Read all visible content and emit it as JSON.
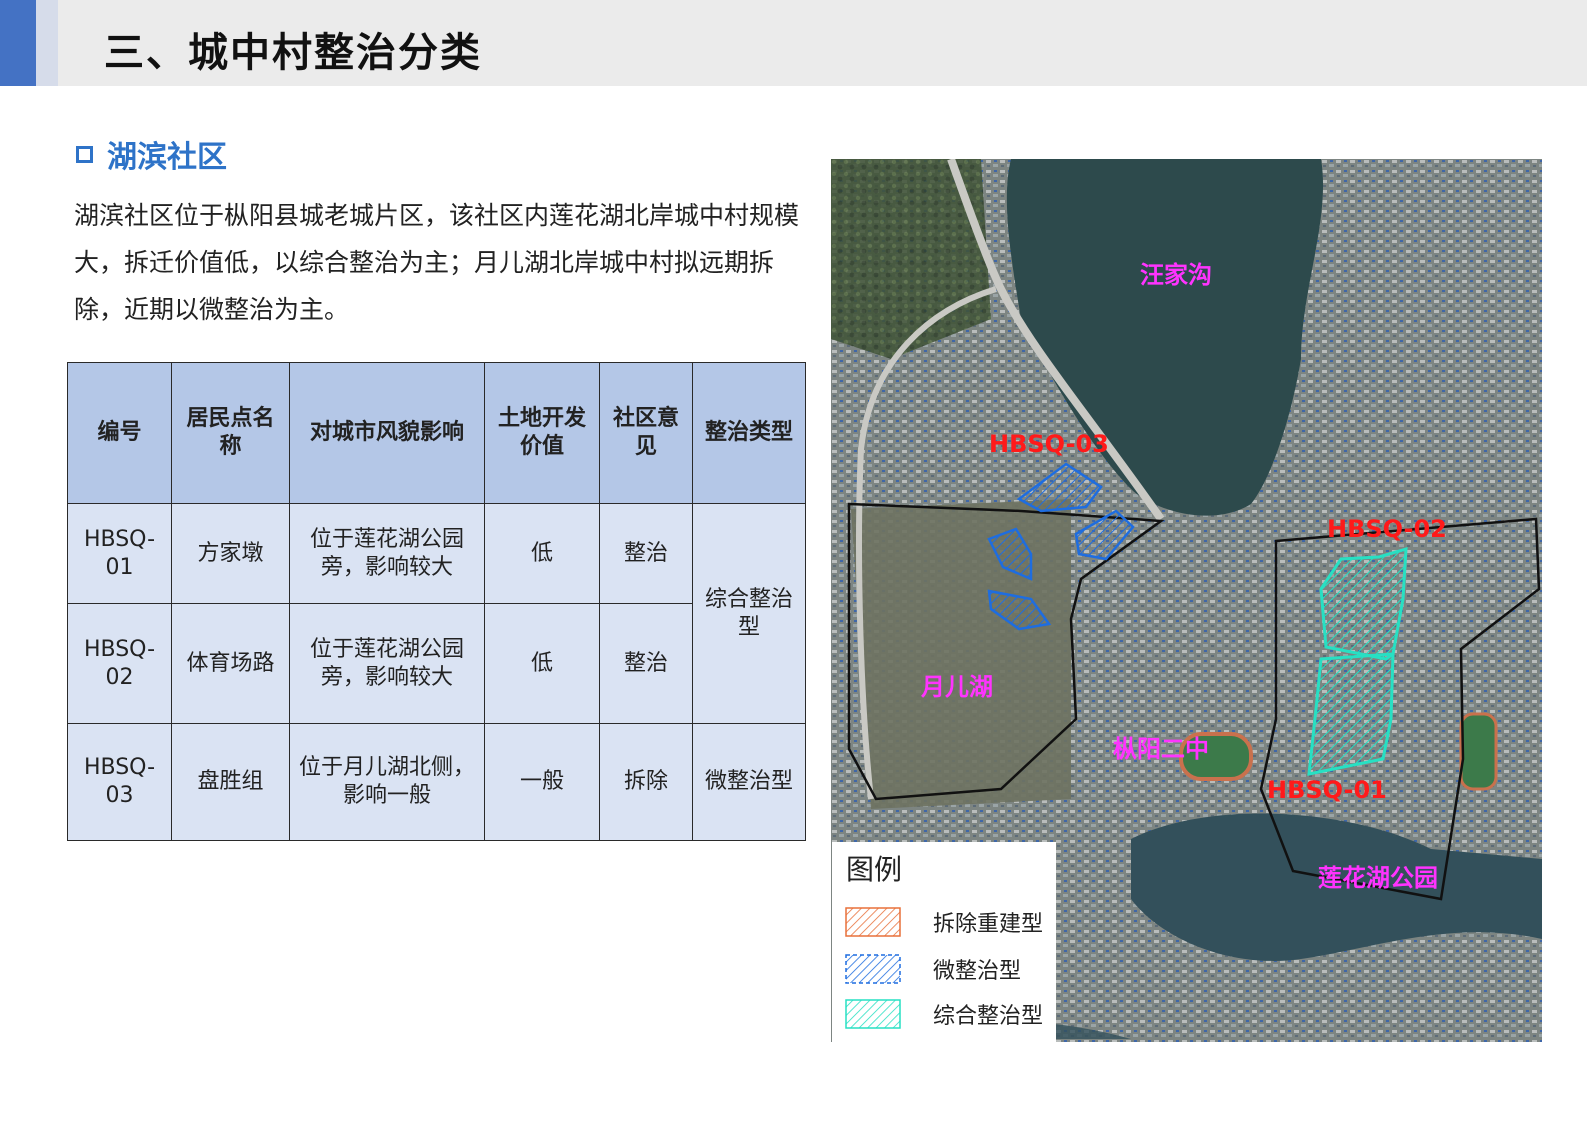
{
  "header": {
    "title": "三、城中村整治分类"
  },
  "section": {
    "title": "湖滨社区",
    "paragraph": "湖滨社区位于枞阳县城老城片区，该社区内莲花湖北岸城中村规模大，拆迁价值低，以综合整治为主；月儿湖北岸城中村拟远期拆除，近期以微整治为主。"
  },
  "table": {
    "headers": [
      "编号",
      "居民点名称",
      "对城市风貌影响",
      "土地开发价值",
      "社区意见",
      "整治类型"
    ],
    "rows": [
      {
        "code": "HBSQ-01",
        "name": "方家墩",
        "impact": "位于莲花湖公园旁，影响较大",
        "value": "低",
        "opinion": "整治"
      },
      {
        "code": "HBSQ-02",
        "name": "体育场路",
        "impact": "位于莲花湖公园旁，影响较大",
        "value": "低",
        "opinion": "整治"
      },
      {
        "code": "HBSQ-03",
        "name": "盘胜组",
        "impact": "位于月儿湖北侧，影响一般",
        "value": "一般",
        "opinion": "拆除"
      }
    ],
    "type_group": "综合整治型",
    "type_row3": "微整治型"
  },
  "map": {
    "labels": {
      "wangjiagou": "汪家沟",
      "yuerhu": "月儿湖",
      "zongyang2": "枞阳二中",
      "lianhuahu": "莲花湖公园",
      "hbsq01": "HBSQ-01",
      "hbsq02": "HBSQ-02",
      "hbsq03": "HBSQ-03"
    },
    "colors": {
      "water": "#2d4a4c",
      "boundary": "#111111",
      "micro": "#1e6de0",
      "comprehensive": "#27e0c3",
      "demolish": "#e8703a"
    }
  },
  "legend": {
    "title": "图例",
    "items": [
      {
        "label": "拆除重建型",
        "color": "#e8703a"
      },
      {
        "label": "微整治型",
        "color": "#1e6de0"
      },
      {
        "label": "综合整治型",
        "color": "#27e0c3"
      }
    ]
  }
}
